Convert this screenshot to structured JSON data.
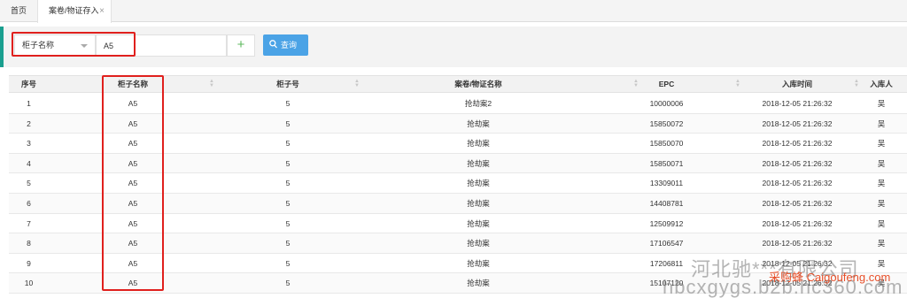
{
  "tabs": {
    "home": "首页",
    "active": "案卷/物证存入",
    "close": "×"
  },
  "search": {
    "select_value": "柜子名称",
    "input_value": "A5",
    "add_symbol": "+",
    "query_label": "查询"
  },
  "table": {
    "headers": [
      "序号",
      "柜子名称",
      "柜子号",
      "案卷/物证名称",
      "EPC",
      "入库时间",
      "入库人"
    ],
    "rows": [
      [
        "1",
        "A5",
        "5",
        "抢劫案2",
        "10000006",
        "2018-12-05 21:26:32",
        "吴"
      ],
      [
        "2",
        "A5",
        "5",
        "抢劫案",
        "15850072",
        "2018-12-05 21:26:32",
        "吴"
      ],
      [
        "3",
        "A5",
        "5",
        "抢劫案",
        "15850070",
        "2018-12-05 21:26:32",
        "吴"
      ],
      [
        "4",
        "A5",
        "5",
        "抢劫案",
        "15850071",
        "2018-12-05 21:26:32",
        "吴"
      ],
      [
        "5",
        "A5",
        "5",
        "抢劫案",
        "13309011",
        "2018-12-05 21:26:32",
        "吴"
      ],
      [
        "6",
        "A5",
        "5",
        "抢劫案",
        "14408781",
        "2018-12-05 21:26:32",
        "吴"
      ],
      [
        "7",
        "A5",
        "5",
        "抢劫案",
        "12509912",
        "2018-12-05 21:26:32",
        "吴"
      ],
      [
        "8",
        "A5",
        "5",
        "抢劫案",
        "17106547",
        "2018-12-05 21:26:32",
        "吴"
      ],
      [
        "9",
        "A5",
        "5",
        "抢劫案",
        "17206811",
        "2018-12-05 21:26:32",
        "吴"
      ],
      [
        "10",
        "A5",
        "5",
        "抢劫案",
        "15107120",
        "2018-12-05 21:26:32",
        "吴"
      ]
    ]
  },
  "watermark": {
    "line1": "河北驰***有限公司",
    "line2": "采购蜂 Caigoufeng.com",
    "line3": "hbcxgygs.b2b.hc360.com"
  },
  "colors": {
    "accent": "#1a9f8f",
    "query_button": "#4ba3e6",
    "highlight_box": "#e0201d"
  }
}
